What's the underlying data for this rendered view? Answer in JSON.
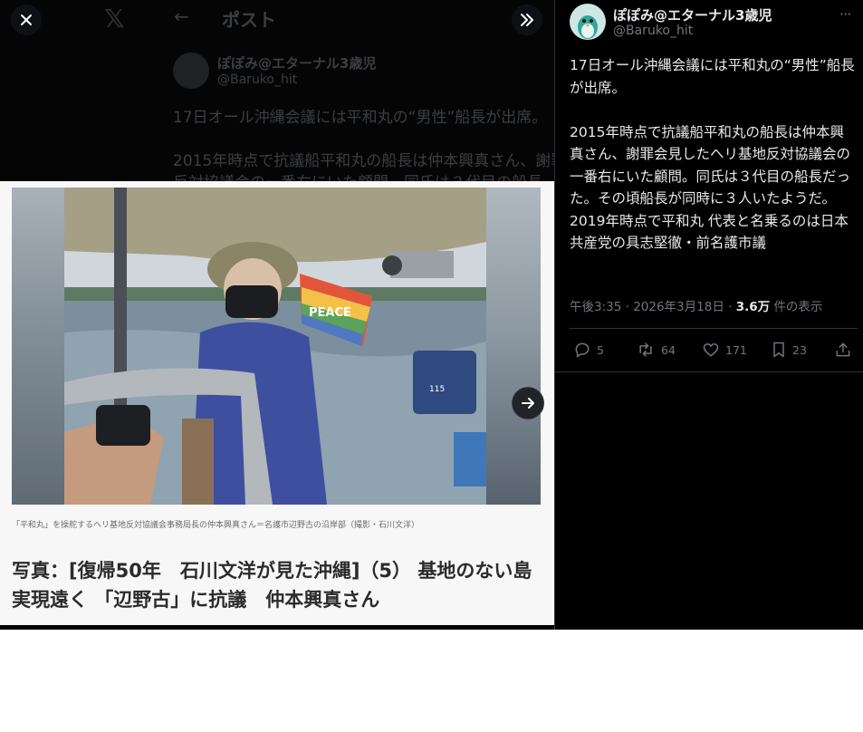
{
  "background_header": {
    "back_glyph": "←",
    "title": "ポスト",
    "display_name": "ぽぽみ@エターナル3歳児",
    "handle": "@Baruko_hit",
    "line1": "17日オール沖縄会議には平和丸の“男性”船長が出席。",
    "line2": "2015年時点で抗議船平和丸の船長は仲本興真さん、謝罪",
    "line3": "反対協議会の一番右にいた顧問。同氏は３代目の船長"
  },
  "viewer": {
    "close_icon": "close-icon",
    "expand_icon": "double-chevron-right-icon",
    "next_icon": "arrow-right-icon",
    "photo_caption": "「平和丸」を操舵するヘリ基地反対協議会事務局長の仲本興真さん＝名護市辺野古の沿岸部（撮影・石川文洋）",
    "article_title": "写真：[復帰50年　石川文洋が見た沖縄]（5）  基地のない島実現遠く 「辺野古」に抗議　仲本興真さん",
    "flag_text": "PEACE",
    "engine_label": "115"
  },
  "tweet": {
    "display_name": "ぽぽみ@エターナル3歳児",
    "handle": "@Baruko_hit",
    "text": "17日オール沖縄会議には平和丸の“男性”船長が出席。\n\n2015年時点で抗議船平和丸の船長は仲本興真さん、謝罪会見したヘリ基地反対協議会の一番右にいた顧問。同氏は３代目の船長だった。その頃船長が同時に３人いたようだ。\n2019年時点で平和丸 代表と名乗るのは日本共産党の具志堅徹・前名護市議",
    "time": "午後3:35 · 2026年3月18日 · ",
    "views": "3.6万",
    "views_suffix": " 件の表示",
    "more": "···",
    "stats": {
      "replies": "5",
      "retweets": "64",
      "likes": "171",
      "bookmarks": "23"
    }
  },
  "colors": {
    "panel_bg": "#000000",
    "text_primary": "#e7e9ea",
    "text_secondary": "#71767b",
    "divider": "#2f3336"
  }
}
